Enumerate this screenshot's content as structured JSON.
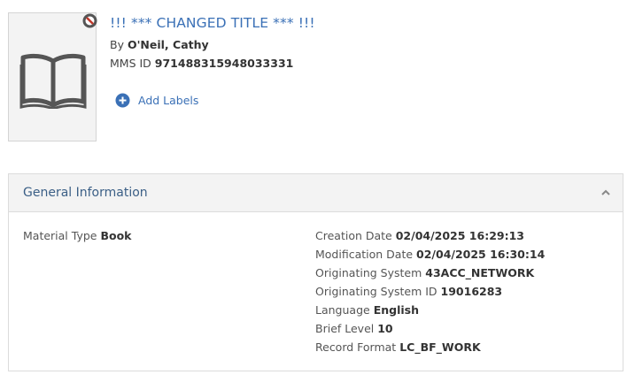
{
  "record": {
    "title": "!!! *** CHANGED TITLE *** !!!",
    "by_prefix": "By",
    "author": "O'Neil, Cathy",
    "mms_label": "MMS ID",
    "mms_id": "971488315948033331"
  },
  "labels": {
    "add_label": "Add Labels"
  },
  "icons": {
    "thumbnail": "open-book-icon",
    "badge": "no-entry-icon",
    "add": "plus-circle-icon",
    "collapse": "chevron-up-icon"
  },
  "colors": {
    "link": "#3a70b6",
    "header_bg": "#f3f3f3"
  },
  "general_info": {
    "heading": "General Information",
    "left": [
      {
        "label": "Material Type",
        "value": "Book"
      }
    ],
    "right": [
      {
        "label": "Creation Date",
        "value": "02/04/2025 16:29:13"
      },
      {
        "label": "Modification Date",
        "value": "02/04/2025 16:30:14"
      },
      {
        "label": "Originating System",
        "value": "43ACC_NETWORK"
      },
      {
        "label": "Originating System ID",
        "value": "19016283"
      },
      {
        "label": "Language",
        "value": "English"
      },
      {
        "label": "Brief Level",
        "value": "10"
      },
      {
        "label": "Record Format",
        "value": "LC_BF_WORK"
      }
    ]
  }
}
